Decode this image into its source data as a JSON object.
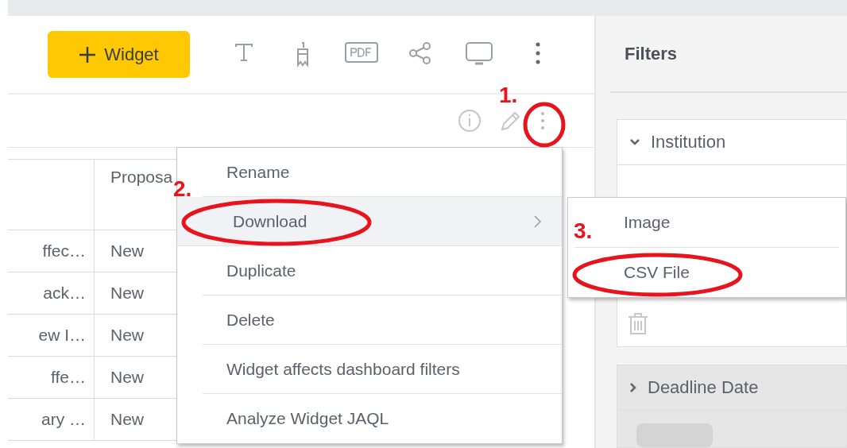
{
  "toolbar": {
    "add_button": "Widget"
  },
  "table": {
    "column_2_header": "Proposa",
    "rows": [
      {
        "column_1": "ffec…",
        "column_2": "New"
      },
      {
        "column_1": "ack…",
        "column_2": "New"
      },
      {
        "column_1": "ew I…",
        "column_2": "New"
      },
      {
        "column_1": "ffe…",
        "column_2": "New"
      },
      {
        "column_1": "ary …",
        "column_2": "New"
      }
    ]
  },
  "widget_menu": [
    {
      "label": "Rename",
      "selected": false,
      "has_submenu": false
    },
    {
      "label": "Download",
      "selected": true,
      "has_submenu": true
    },
    {
      "label": "Duplicate",
      "selected": false,
      "has_submenu": false
    },
    {
      "label": "Delete",
      "selected": false,
      "has_submenu": false
    },
    {
      "label": "Widget affects dashboard filters",
      "selected": false,
      "has_submenu": false
    },
    {
      "label": "Analyze Widget JAQL",
      "selected": false,
      "has_submenu": false
    }
  ],
  "download_submenu": [
    {
      "label": "Image"
    },
    {
      "label": "CSV File"
    }
  ],
  "filters": {
    "title": "Filters",
    "groups": [
      {
        "title": "Institution",
        "expanded": true
      },
      {
        "title": "Deadline Date",
        "expanded": false
      }
    ]
  },
  "annotations": [
    {
      "label": "1."
    },
    {
      "label": "2."
    },
    {
      "label": "3."
    }
  ]
}
